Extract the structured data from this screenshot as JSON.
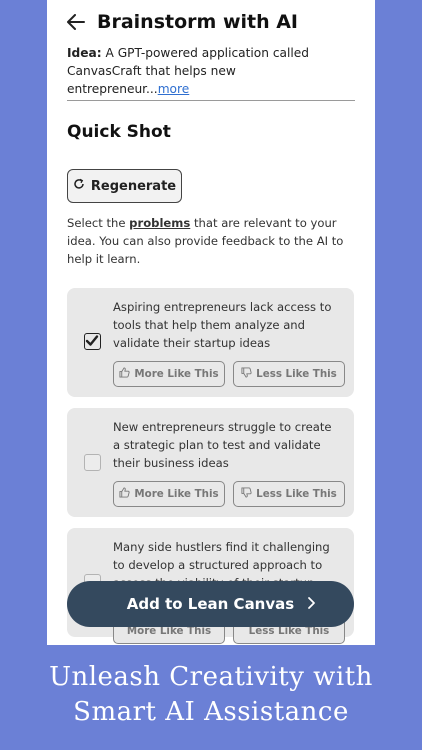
{
  "header": {
    "title": "Brainstorm with AI"
  },
  "idea": {
    "label": "Idea:",
    "text": " A GPT-powered application called CanvasCraft that helps new entrepreneur...",
    "more_link": "more"
  },
  "section": {
    "title": "Quick Shot"
  },
  "regenerate_label": "Regenerate",
  "instructions": {
    "before": "Select the ",
    "keyword": "problems",
    "after": " that are relevant to your idea. You can also provide feedback to the AI to help it learn."
  },
  "problems": [
    {
      "text": "Aspiring entrepreneurs lack access to tools that help them analyze and validate their startup ideas",
      "checked": true,
      "more_label": "More Like This",
      "less_label": "Less Like This"
    },
    {
      "text": "New entrepreneurs struggle to create a strategic plan to test and validate their business ideas",
      "checked": false,
      "more_label": "More Like This",
      "less_label": "Less Like This"
    },
    {
      "text": "Many side hustlers find it challenging to develop a structured approach to assess the viability of their startup concepts",
      "checked": false,
      "more_label": "More Like This",
      "less_label": "Less Like This"
    }
  ],
  "fab_label": "Add to Lean Canvas",
  "tagline": {
    "line1": "Unleash Creativity with",
    "line2": "Smart AI Assistance"
  },
  "colors": {
    "background": "#6b80d6",
    "fab": "#34495e",
    "link": "#2f6fd0",
    "card": "#e8e8e8"
  },
  "icons": {
    "back": "arrow-left-icon",
    "regenerate": "refresh-icon",
    "more": "thumbs-up-icon",
    "less": "thumbs-down-icon",
    "fab": "chevron-right-icon"
  }
}
